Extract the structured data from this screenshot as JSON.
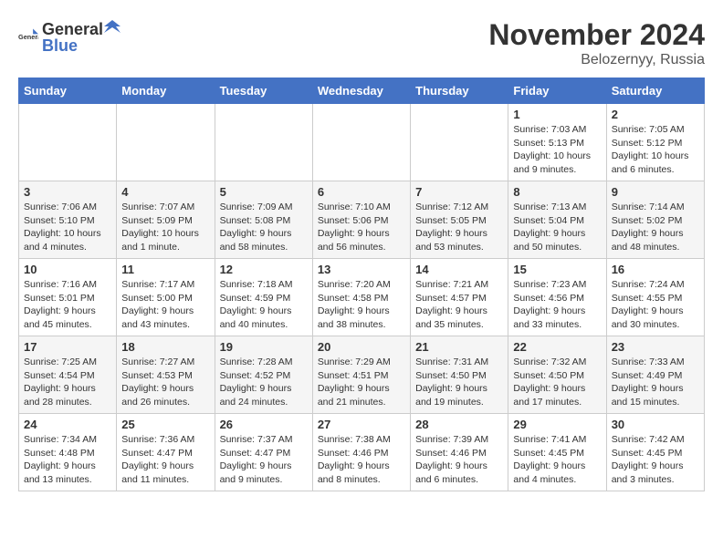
{
  "logo": {
    "text_general": "General",
    "text_blue": "Blue"
  },
  "title": {
    "month": "November 2024",
    "location": "Belozernyy, Russia"
  },
  "weekdays": [
    "Sunday",
    "Monday",
    "Tuesday",
    "Wednesday",
    "Thursday",
    "Friday",
    "Saturday"
  ],
  "weeks": [
    [
      {
        "day": "",
        "info": ""
      },
      {
        "day": "",
        "info": ""
      },
      {
        "day": "",
        "info": ""
      },
      {
        "day": "",
        "info": ""
      },
      {
        "day": "",
        "info": ""
      },
      {
        "day": "1",
        "info": "Sunrise: 7:03 AM\nSunset: 5:13 PM\nDaylight: 10 hours and 9 minutes."
      },
      {
        "day": "2",
        "info": "Sunrise: 7:05 AM\nSunset: 5:12 PM\nDaylight: 10 hours and 6 minutes."
      }
    ],
    [
      {
        "day": "3",
        "info": "Sunrise: 7:06 AM\nSunset: 5:10 PM\nDaylight: 10 hours and 4 minutes."
      },
      {
        "day": "4",
        "info": "Sunrise: 7:07 AM\nSunset: 5:09 PM\nDaylight: 10 hours and 1 minute."
      },
      {
        "day": "5",
        "info": "Sunrise: 7:09 AM\nSunset: 5:08 PM\nDaylight: 9 hours and 58 minutes."
      },
      {
        "day": "6",
        "info": "Sunrise: 7:10 AM\nSunset: 5:06 PM\nDaylight: 9 hours and 56 minutes."
      },
      {
        "day": "7",
        "info": "Sunrise: 7:12 AM\nSunset: 5:05 PM\nDaylight: 9 hours and 53 minutes."
      },
      {
        "day": "8",
        "info": "Sunrise: 7:13 AM\nSunset: 5:04 PM\nDaylight: 9 hours and 50 minutes."
      },
      {
        "day": "9",
        "info": "Sunrise: 7:14 AM\nSunset: 5:02 PM\nDaylight: 9 hours and 48 minutes."
      }
    ],
    [
      {
        "day": "10",
        "info": "Sunrise: 7:16 AM\nSunset: 5:01 PM\nDaylight: 9 hours and 45 minutes."
      },
      {
        "day": "11",
        "info": "Sunrise: 7:17 AM\nSunset: 5:00 PM\nDaylight: 9 hours and 43 minutes."
      },
      {
        "day": "12",
        "info": "Sunrise: 7:18 AM\nSunset: 4:59 PM\nDaylight: 9 hours and 40 minutes."
      },
      {
        "day": "13",
        "info": "Sunrise: 7:20 AM\nSunset: 4:58 PM\nDaylight: 9 hours and 38 minutes."
      },
      {
        "day": "14",
        "info": "Sunrise: 7:21 AM\nSunset: 4:57 PM\nDaylight: 9 hours and 35 minutes."
      },
      {
        "day": "15",
        "info": "Sunrise: 7:23 AM\nSunset: 4:56 PM\nDaylight: 9 hours and 33 minutes."
      },
      {
        "day": "16",
        "info": "Sunrise: 7:24 AM\nSunset: 4:55 PM\nDaylight: 9 hours and 30 minutes."
      }
    ],
    [
      {
        "day": "17",
        "info": "Sunrise: 7:25 AM\nSunset: 4:54 PM\nDaylight: 9 hours and 28 minutes."
      },
      {
        "day": "18",
        "info": "Sunrise: 7:27 AM\nSunset: 4:53 PM\nDaylight: 9 hours and 26 minutes."
      },
      {
        "day": "19",
        "info": "Sunrise: 7:28 AM\nSunset: 4:52 PM\nDaylight: 9 hours and 24 minutes."
      },
      {
        "day": "20",
        "info": "Sunrise: 7:29 AM\nSunset: 4:51 PM\nDaylight: 9 hours and 21 minutes."
      },
      {
        "day": "21",
        "info": "Sunrise: 7:31 AM\nSunset: 4:50 PM\nDaylight: 9 hours and 19 minutes."
      },
      {
        "day": "22",
        "info": "Sunrise: 7:32 AM\nSunset: 4:50 PM\nDaylight: 9 hours and 17 minutes."
      },
      {
        "day": "23",
        "info": "Sunrise: 7:33 AM\nSunset: 4:49 PM\nDaylight: 9 hours and 15 minutes."
      }
    ],
    [
      {
        "day": "24",
        "info": "Sunrise: 7:34 AM\nSunset: 4:48 PM\nDaylight: 9 hours and 13 minutes."
      },
      {
        "day": "25",
        "info": "Sunrise: 7:36 AM\nSunset: 4:47 PM\nDaylight: 9 hours and 11 minutes."
      },
      {
        "day": "26",
        "info": "Sunrise: 7:37 AM\nSunset: 4:47 PM\nDaylight: 9 hours and 9 minutes."
      },
      {
        "day": "27",
        "info": "Sunrise: 7:38 AM\nSunset: 4:46 PM\nDaylight: 9 hours and 8 minutes."
      },
      {
        "day": "28",
        "info": "Sunrise: 7:39 AM\nSunset: 4:46 PM\nDaylight: 9 hours and 6 minutes."
      },
      {
        "day": "29",
        "info": "Sunrise: 7:41 AM\nSunset: 4:45 PM\nDaylight: 9 hours and 4 minutes."
      },
      {
        "day": "30",
        "info": "Sunrise: 7:42 AM\nSunset: 4:45 PM\nDaylight: 9 hours and 3 minutes."
      }
    ]
  ]
}
